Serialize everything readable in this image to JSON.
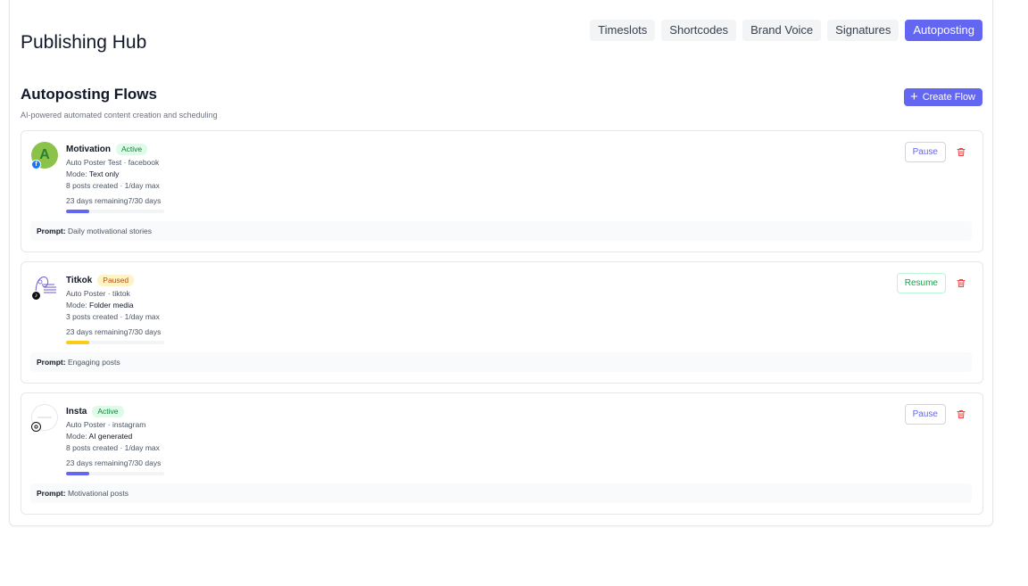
{
  "header": {
    "title": "Publishing Hub",
    "tabs": [
      {
        "label": "Timeslots",
        "active": false
      },
      {
        "label": "Shortcodes",
        "active": false
      },
      {
        "label": "Brand Voice",
        "active": false
      },
      {
        "label": "Signatures",
        "active": false
      },
      {
        "label": "Autoposting",
        "active": true
      }
    ]
  },
  "section": {
    "title": "Autoposting Flows",
    "subtitle": "AI-powered automated content creation and scheduling",
    "create_label": "Create Flow"
  },
  "colors": {
    "accent": "#6366f1",
    "active_badge": "#15803d",
    "paused_badge": "#b45309",
    "progress_active": "#6366f1",
    "progress_paused": "#facc15",
    "delete": "#ef4444"
  },
  "flows": [
    {
      "name": "Motivation",
      "status": "Active",
      "avatar_letter": "A",
      "platform_icon": "facebook-icon",
      "account": "Auto Poster Test · facebook",
      "mode_label": "Mode: ",
      "mode": "Text only",
      "posts": "8 posts created · 1/day max",
      "remaining": "23 days remaining7/30 days",
      "progress": 0.233,
      "prompt_label": "Prompt:",
      "prompt": "Daily motivational stories",
      "action": "Pause"
    },
    {
      "name": "Titkok",
      "status": "Paused",
      "avatar_letter": "",
      "platform_icon": "tiktok-icon",
      "account": "Auto Poster · tiktok",
      "mode_label": "Mode: ",
      "mode": "Folder media",
      "posts": "3 posts created · 1/day max",
      "remaining": "23 days remaining7/30 days",
      "progress": 0.233,
      "prompt_label": "Prompt:",
      "prompt": "Engaging posts",
      "action": "Resume"
    },
    {
      "name": "Insta",
      "status": "Active",
      "avatar_letter": "",
      "platform_icon": "instagram-icon",
      "account": "Auto Poster · instagram",
      "mode_label": "Mode: ",
      "mode": "AI generated",
      "posts": "8 posts created · 1/day max",
      "remaining": "23 days remaining7/30 days",
      "progress": 0.233,
      "prompt_label": "Prompt:",
      "prompt": "Motivational posts",
      "action": "Pause"
    }
  ]
}
